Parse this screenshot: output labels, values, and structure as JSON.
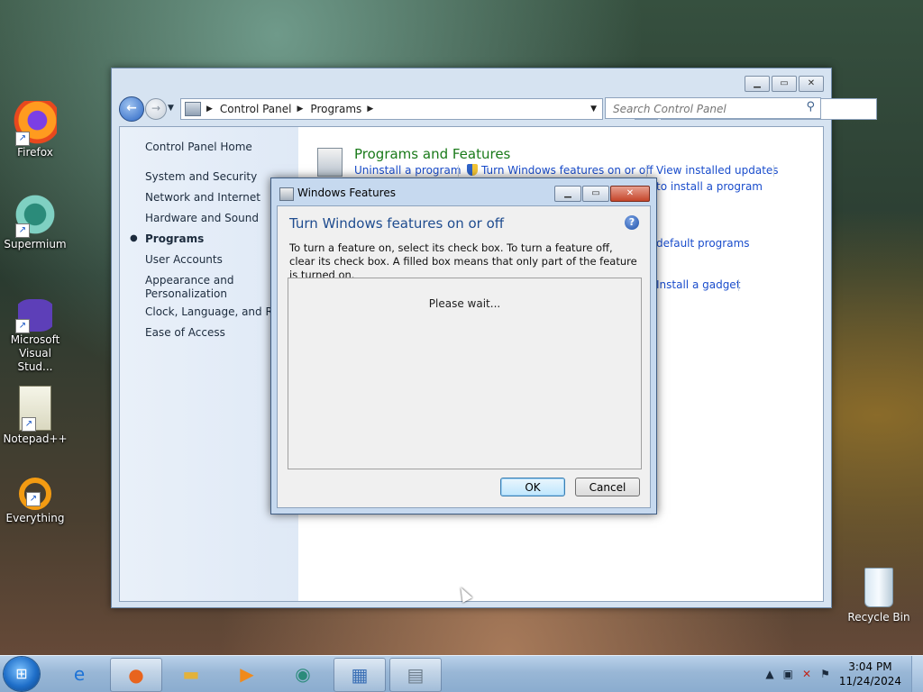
{
  "desktop": {
    "icons": [
      {
        "label": "Firefox",
        "icon": "firefox-icon"
      },
      {
        "label": "Supermium",
        "icon": "supermium-icon"
      },
      {
        "label": "Microsoft Visual Stud...",
        "icon": "visual-studio-icon"
      },
      {
        "label": "Notepad++",
        "icon": "notepad-plus-plus-icon"
      },
      {
        "label": "Everything",
        "icon": "everything-icon"
      }
    ],
    "recycle_bin": "Recycle Bin"
  },
  "control_panel": {
    "address": {
      "crumbs": [
        "Control Panel",
        "Programs"
      ]
    },
    "search": {
      "placeholder": "Search Control Panel"
    },
    "left_nav": {
      "items": [
        "Control Panel Home",
        "System and Security",
        "Network and Internet",
        "Hardware and Sound",
        "Programs",
        "User Accounts",
        "Appearance and Personalization",
        "Clock, Language, and Regi",
        "Ease of Access"
      ],
      "active": "Programs"
    },
    "main": {
      "category_title": "Programs and Features",
      "tasks": [
        "Uninstall a program",
        "Turn Windows features on or off",
        "View installed updates",
        "to install a program",
        "default programs",
        "Install a gadget"
      ]
    }
  },
  "dialog": {
    "title": "Windows Features",
    "heading": "Turn Windows features on or off",
    "description": "To turn a feature on, select its check box. To turn a feature off, clear its check box. A filled box means that only part of the feature is turned on.",
    "status": "Please wait...",
    "ok_label": "OK",
    "cancel_label": "Cancel"
  },
  "taskbar": {
    "clock_time": "3:04 PM",
    "clock_date": "11/24/2024",
    "pinned": [
      "internet-explorer-icon",
      "firefox-icon",
      "file-explorer-icon",
      "media-player-icon",
      "supermium-icon",
      "control-panel-icon",
      "windows-features-icon"
    ]
  },
  "colors": {
    "link": "#1a4dcc",
    "category_title": "#1a7a1a",
    "dialog_heading": "#1f4c8f"
  }
}
